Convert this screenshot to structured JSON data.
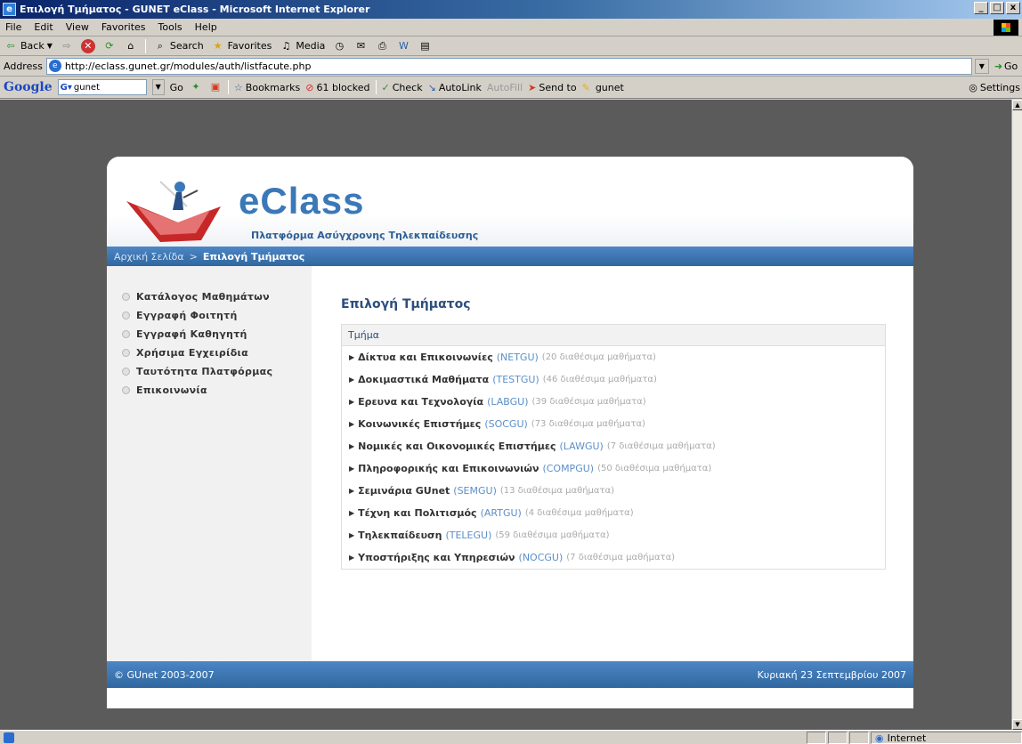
{
  "window": {
    "title": "Επιλογή Τμήματος - GUNET eClass - Microsoft Internet Explorer",
    "buttons": [
      "_",
      "□",
      "x"
    ]
  },
  "menu": [
    "File",
    "Edit",
    "View",
    "Favorites",
    "Tools",
    "Help"
  ],
  "toolbar": {
    "back": "Back",
    "search": "Search",
    "favorites": "Favorites",
    "media": "Media"
  },
  "address": {
    "label": "Address",
    "url": "http://eclass.gunet.gr/modules/auth/listfacute.php",
    "go": "Go"
  },
  "google_bar": {
    "logo": "Google",
    "query": "gunet",
    "go": "Go",
    "bookmarks": "Bookmarks",
    "blocked": "61 blocked",
    "check": "Check",
    "autolink": "AutoLink",
    "autofill": "AutoFill",
    "send_to": "Send to",
    "gunet": "gunet",
    "settings": "Settings"
  },
  "site": {
    "brand": "eClass",
    "tagline": "Πλατφόρμα Ασύγχρονης Τηλεκπαίδευσης",
    "breadcrumb_home": "Αρχική Σελίδα",
    "breadcrumb_sep": ">",
    "breadcrumb_current": "Επιλογή Τμήματος"
  },
  "sidebar": [
    "Κατάλογος Μαθημάτων",
    "Εγγραφή Φοιτητή",
    "Εγγραφή Καθηγητή",
    "Χρήσιμα Εγχειρίδια",
    "Ταυτότητα Πλατφόρμας",
    "Επικοινωνία"
  ],
  "main": {
    "title": "Επιλογή Τμήματος",
    "column_header": "Τμήμα",
    "departments": [
      {
        "name": "Δίκτυα και Επικοινωνίες",
        "code": "(NETGU)",
        "avail": "(20 διαθέσιμα μαθήματα)"
      },
      {
        "name": "Δοκιμαστικά Μαθήματα",
        "code": "(TESTGU)",
        "avail": "(46 διαθέσιμα μαθήματα)"
      },
      {
        "name": "Ερευνα και Τεχνολογία",
        "code": "(LABGU)",
        "avail": "(39 διαθέσιμα μαθήματα)"
      },
      {
        "name": "Κοινωνικές Επιστήμες",
        "code": "(SOCGU)",
        "avail": "(73 διαθέσιμα μαθήματα)"
      },
      {
        "name": "Νομικές και Οικονομικές Επιστήμες",
        "code": "(LAWGU)",
        "avail": "(7 διαθέσιμα μαθήματα)"
      },
      {
        "name": "Πληροφορικής και Επικοινωνιών",
        "code": "(COMPGU)",
        "avail": "(50 διαθέσιμα μαθήματα)"
      },
      {
        "name": "Σεμινάρια GUnet",
        "code": "(SEMGU)",
        "avail": "(13 διαθέσιμα μαθήματα)"
      },
      {
        "name": "Τέχνη και Πολιτισμός",
        "code": "(ARTGU)",
        "avail": "(4 διαθέσιμα μαθήματα)"
      },
      {
        "name": "Τηλεκπαίδευση",
        "code": "(TELEGU)",
        "avail": "(59 διαθέσιμα μαθήματα)"
      },
      {
        "name": "Υποστήριξης και Υπηρεσιών",
        "code": "(NOCGU)",
        "avail": "(7 διαθέσιμα μαθήματα)"
      }
    ]
  },
  "footer": {
    "copyright": "© GUnet 2003-2007",
    "date": "Κυριακή 23 Σεπτεμβρίου 2007"
  },
  "status": {
    "zone": "Internet"
  },
  "colors": {
    "brand_blue": "#3b78b8",
    "bar_blue": "#30679f",
    "link_blue": "#5b8fc8",
    "title_blue": "#2c4e7d"
  }
}
